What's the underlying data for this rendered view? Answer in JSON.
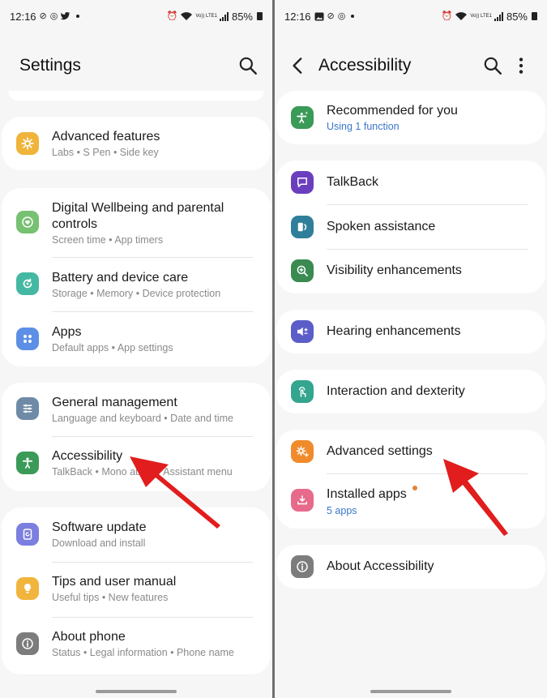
{
  "status_bar": {
    "time": "12:16",
    "battery": "85%",
    "network_label": "Vo)) LTE1"
  },
  "colors": {
    "accent_blue": "#3a78c9",
    "arrow_red": "#e11d1d",
    "background": "#f6f6f6"
  },
  "settings": {
    "title": "Settings",
    "groups": [
      [
        {
          "title": "Advanced features",
          "subtitle": "Labs  •  S Pen  •  Side key",
          "icon": "gear-plus-icon",
          "icon_color": "#f0b43a"
        }
      ],
      [
        {
          "title": "Digital Wellbeing and parental controls",
          "subtitle": "Screen time  •  App timers",
          "icon": "heart-circle-icon",
          "icon_color": "#76c172"
        },
        {
          "title": "Battery and device care",
          "subtitle": "Storage  •  Memory  •  Device protection",
          "icon": "refresh-circle-icon",
          "icon_color": "#44b8a2"
        },
        {
          "title": "Apps",
          "subtitle": "Default apps  •  App settings",
          "icon": "apps-grid-icon",
          "icon_color": "#5e8fe6"
        }
      ],
      [
        {
          "title": "General management",
          "subtitle": "Language and keyboard  •  Date and time",
          "icon": "sliders-icon",
          "icon_color": "#6f8aa6"
        },
        {
          "title": "Accessibility",
          "subtitle": "TalkBack  •  Mono audio  •  Assistant menu",
          "icon": "accessibility-person-icon",
          "icon_color": "#3a9a57"
        }
      ],
      [
        {
          "title": "Software update",
          "subtitle": "Download and install",
          "icon": "update-icon",
          "icon_color": "#7b7fe0"
        },
        {
          "title": "Tips and user manual",
          "subtitle": "Useful tips  •  New features",
          "icon": "lightbulb-icon",
          "icon_color": "#f1b43c"
        },
        {
          "title": "About phone",
          "subtitle": "Status  •  Legal information  •  Phone name",
          "icon": "info-icon",
          "icon_color": "#7c7c7c"
        }
      ]
    ]
  },
  "accessibility": {
    "title": "Accessibility",
    "groups": [
      [
        {
          "title": "Recommended for you",
          "subtitle": "Using 1 function",
          "subtitle_blue": true,
          "icon": "accessibility-sparkle-icon",
          "icon_color": "#3a9a57"
        }
      ],
      [
        {
          "title": "TalkBack",
          "icon": "speech-bubble-icon",
          "icon_color": "#6a3fbf"
        },
        {
          "title": "Spoken assistance",
          "icon": "speaker-icon",
          "icon_color": "#2f7f9a"
        },
        {
          "title": "Visibility enhancements",
          "icon": "magnifier-icon",
          "icon_color": "#3a8a52"
        }
      ],
      [
        {
          "title": "Hearing enhancements",
          "icon": "volume-icon",
          "icon_color": "#5b5ec8"
        }
      ],
      [
        {
          "title": "Interaction and dexterity",
          "icon": "touch-hand-icon",
          "icon_color": "#34a58e"
        }
      ],
      [
        {
          "title": "Advanced settings",
          "icon": "gear-plus-icon",
          "icon_color": "#f08b2c"
        },
        {
          "title": "Installed apps",
          "subtitle": "5 apps",
          "subtitle_blue": true,
          "icon": "download-box-icon",
          "icon_color": "#e76a8a",
          "badge": true
        }
      ],
      [
        {
          "title": "About Accessibility",
          "icon": "info-icon",
          "icon_color": "#7c7c7c"
        }
      ]
    ]
  }
}
